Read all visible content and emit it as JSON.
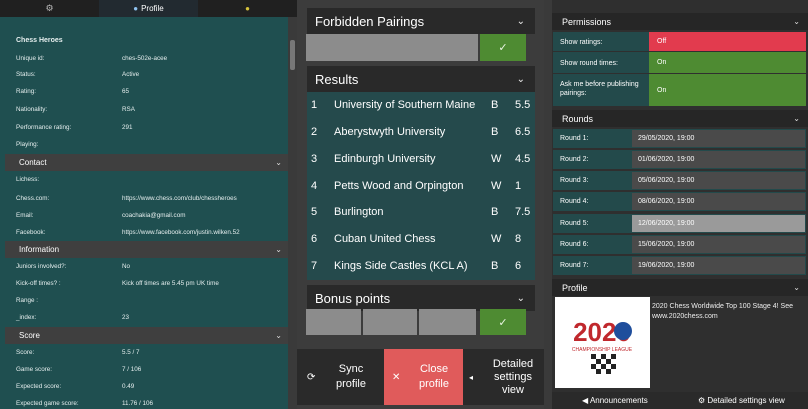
{
  "tabs": [
    {
      "icon": "gear-icon",
      "label": ""
    },
    {
      "icon": "person-icon",
      "label": "Profile"
    },
    {
      "icon": "dot-icon",
      "label": ""
    }
  ],
  "profile": {
    "title": "Chess Heroes",
    "rows": [
      {
        "label": "Unique id:",
        "value": "ches-502e-acee"
      },
      {
        "label": "Status:",
        "value": "Active"
      },
      {
        "label": "Rating:",
        "value": "65"
      },
      {
        "label": "Nationality:",
        "value": "RSA"
      },
      {
        "label": "Performance rating:",
        "value": "291"
      },
      {
        "label": "Playing:",
        "value": ""
      }
    ]
  },
  "contact": {
    "header": "Contact",
    "rows": [
      {
        "label": "Lichess:",
        "value": ""
      },
      {
        "label": "Chess.com:",
        "value": "https://www.chess.com/club/chessheroes"
      },
      {
        "label": "Email:",
        "value": "coachakia@gmail.com"
      },
      {
        "label": "Facebook:",
        "value": "https://www.facebook.com/justin.wilken.52"
      }
    ]
  },
  "information": {
    "header": "Information",
    "rows": [
      {
        "label": "Juniors involved?:",
        "value": "No"
      },
      {
        "label": "Kick-off times? :",
        "value": "Kick off times are 5.45 pm UK time"
      },
      {
        "label": "Range :",
        "value": ""
      },
      {
        "label": "_index:",
        "value": "23"
      }
    ]
  },
  "score": {
    "header": "Score",
    "rows": [
      {
        "label": "Score:",
        "value": "5.5 / 7"
      },
      {
        "label": "Game score:",
        "value": "7 / 106"
      },
      {
        "label": "Expected score:",
        "value": "0.49"
      },
      {
        "label": "Expected game score:",
        "value": "11.76 / 106"
      }
    ]
  },
  "forbidden": {
    "header": "Forbidden Pairings",
    "check": "✓"
  },
  "results": {
    "header": "Results",
    "rows": [
      {
        "num": "1",
        "name": "University of Southern Maine",
        "col": "B",
        "pts": "5.5"
      },
      {
        "num": "2",
        "name": "Aberystwyth University",
        "col": "B",
        "pts": "6.5"
      },
      {
        "num": "3",
        "name": "Edinburgh University",
        "col": "W",
        "pts": "4.5"
      },
      {
        "num": "4",
        "name": "Petts Wood and Orpington",
        "col": "W",
        "pts": "1"
      },
      {
        "num": "5",
        "name": "Burlington",
        "col": "B",
        "pts": "7.5"
      },
      {
        "num": "6",
        "name": "Cuban United Chess",
        "col": "W",
        "pts": "8"
      },
      {
        "num": "7",
        "name": "Kings Side Castles (KCL A)",
        "col": "B",
        "pts": "6"
      }
    ]
  },
  "bonus": {
    "header": "Bonus points",
    "check": "✓"
  },
  "footer": {
    "sync_line1": "Sync",
    "sync_line2": "profile",
    "close_line1": "Close",
    "close_line2": "profile",
    "detail_line1": "Detailed",
    "detail_line2": "settings",
    "detail_line3": "view",
    "colors": {
      "close": "#e05b5b"
    }
  },
  "permissions": {
    "header": "Permissions",
    "rows": [
      {
        "label": "Show ratings:",
        "value": "Off",
        "color": "#e23b4e"
      },
      {
        "label": "Show round times:",
        "value": "On",
        "color": "#4e8b32"
      },
      {
        "label": "Ask me before publishing pairings:",
        "value": "On",
        "color": "#4e8b32"
      }
    ]
  },
  "rounds": {
    "header": "Rounds",
    "rows": [
      {
        "label": "Round 1:",
        "value": "29/05/2020, 19:00"
      },
      {
        "label": "Round 2:",
        "value": "01/06/2020, 19:00"
      },
      {
        "label": "Round 3:",
        "value": "05/06/2020, 19:00"
      },
      {
        "label": "Round 4:",
        "value": "08/06/2020, 19:00"
      },
      {
        "label": "Round 5:",
        "value": "12/06/2020, 19:00"
      },
      {
        "label": "Round 6:",
        "value": "15/06/2020, 19:00"
      },
      {
        "label": "Round 7:",
        "value": "19/06/2020, 19:00"
      }
    ]
  },
  "profile_panel": {
    "header": "Profile",
    "text": "2020 Chess Worldwide Top 100 Stage 4! See www.2020chess.com",
    "logo_year": "2020",
    "logo_caption": "CHAMPIONSHIP LEAGUE"
  },
  "bottom_bar": {
    "announcements": "Announcements",
    "detailed": "Detailed settings view"
  }
}
